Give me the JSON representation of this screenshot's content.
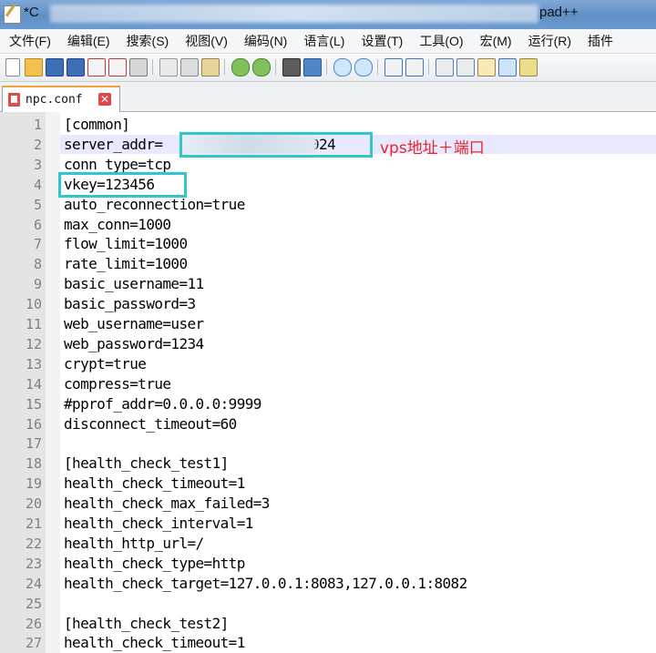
{
  "window": {
    "title_prefix": "*C",
    "title_suffix": "pad++"
  },
  "menu": [
    {
      "id": "file",
      "label": "文件(F)"
    },
    {
      "id": "edit",
      "label": "编辑(E)"
    },
    {
      "id": "search",
      "label": "搜索(S)"
    },
    {
      "id": "view",
      "label": "视图(V)"
    },
    {
      "id": "encoding",
      "label": "编码(N)"
    },
    {
      "id": "language",
      "label": "语言(L)"
    },
    {
      "id": "settings",
      "label": "设置(T)"
    },
    {
      "id": "tools",
      "label": "工具(O)"
    },
    {
      "id": "macro",
      "label": "宏(M)"
    },
    {
      "id": "run",
      "label": "运行(R)"
    },
    {
      "id": "plugins",
      "label": "插件"
    }
  ],
  "toolbar_icons": [
    "new-file-icon",
    "open-file-icon",
    "save-icon",
    "save-all-icon",
    "close-icon",
    "close-all-icon",
    "print-icon",
    "cut-icon",
    "copy-icon",
    "paste-icon",
    "undo-icon",
    "redo-icon",
    "find-icon",
    "replace-icon",
    "zoom-in-icon",
    "zoom-out-icon",
    "sync-vertical-icon",
    "sync-horizontal-icon",
    "word-wrap-icon",
    "show-all-chars-icon",
    "indent-guide-icon",
    "doc-map-icon",
    "function-list-icon"
  ],
  "tab": {
    "label": "npc.conf",
    "close_glyph": "✕"
  },
  "editor": {
    "current_line": 2,
    "lines": [
      "[common]",
      "server_addr=                :8024",
      "conn_type=tcp",
      "vkey=123456",
      "auto_reconnection=true",
      "max_conn=1000",
      "flow_limit=1000",
      "rate_limit=1000",
      "basic_username=11",
      "basic_password=3",
      "web_username=user",
      "web_password=1234",
      "crypt=true",
      "compress=true",
      "#pprof_addr=0.0.0.0:9999",
      "disconnect_timeout=60",
      "",
      "[health_check_test1]",
      "health_check_timeout=1",
      "health_check_max_failed=3",
      "health_check_interval=1",
      "health_http_url=/",
      "health_check_type=http",
      "health_check_target=127.0.0.1:8083,127.0.0.1:8082",
      "",
      "[health_check_test2]",
      "health_check_timeout=1"
    ]
  },
  "annotation": {
    "text": "vps地址＋端口",
    "color": "#e8262a",
    "box_color": "#2fc7cb"
  }
}
